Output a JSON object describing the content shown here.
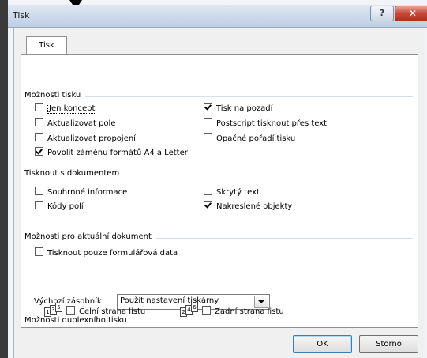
{
  "window": {
    "title": "Tisk",
    "help_label": "?",
    "close_label": "✕"
  },
  "tab": {
    "label": "Tisk"
  },
  "groups": {
    "print_options": {
      "title": "Možnosti tisku",
      "left": [
        {
          "label": "Jen koncept",
          "checked": false
        },
        {
          "label": "Aktualizovat pole",
          "checked": false
        },
        {
          "label": "Aktualizovat propojení",
          "checked": false
        },
        {
          "label": "Povolit záměnu formátů A4 a Letter",
          "checked": true
        }
      ],
      "right": [
        {
          "label": "Tisk na pozadí",
          "checked": true
        },
        {
          "label": "Postscript tisknout přes text",
          "checked": false
        },
        {
          "label": "Opačné pořadí tisku",
          "checked": false
        }
      ]
    },
    "print_with_document": {
      "title": "Tisknout s dokumentem",
      "left": [
        {
          "label": "Souhrnné informace",
          "checked": false
        },
        {
          "label": "Kódy polí",
          "checked": false
        }
      ],
      "right": [
        {
          "label": "Skrytý text",
          "checked": false
        },
        {
          "label": "Nakreslené objekty",
          "checked": true
        }
      ]
    },
    "current_document": {
      "title": "Možnosti pro aktuální dokument",
      "items": [
        {
          "label": "Tisknout pouze formulářová data",
          "checked": false
        }
      ]
    },
    "duplex": {
      "title": "Možnosti duplexního tisku",
      "front": {
        "label": "Čelní strana listu",
        "checked": false,
        "pages": [
          "1",
          "3",
          "5"
        ]
      },
      "back": {
        "label": "Zadní strana listu",
        "checked": false,
        "pages": [
          "2",
          "4",
          "6"
        ]
      }
    }
  },
  "tray": {
    "label": "Výchozí zásobník:",
    "value": "Použít nastavení tiskárny"
  },
  "buttons": {
    "ok": "OK",
    "cancel": "Storno"
  }
}
